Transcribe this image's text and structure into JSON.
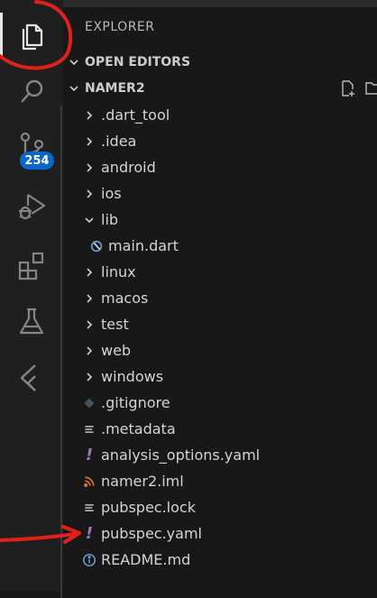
{
  "activity_bar": {
    "scm_badge": "254",
    "icons": [
      "files-icon",
      "search-icon",
      "source-control-icon",
      "run-debug-icon",
      "extensions-icon",
      "testing-icon",
      "flutter-icon"
    ]
  },
  "explorer": {
    "title": "EXPLORER",
    "open_editors_label": "OPEN EDITORS",
    "project_label": "NAMER2",
    "tree": [
      {
        "label": ".dart_tool",
        "kind": "folder"
      },
      {
        "label": ".idea",
        "kind": "folder"
      },
      {
        "label": "android",
        "kind": "folder"
      },
      {
        "label": "ios",
        "kind": "folder"
      },
      {
        "label": "lib",
        "kind": "folder-open"
      },
      {
        "label": "main.dart",
        "kind": "dart"
      },
      {
        "label": "linux",
        "kind": "folder"
      },
      {
        "label": "macos",
        "kind": "folder"
      },
      {
        "label": "test",
        "kind": "folder"
      },
      {
        "label": "web",
        "kind": "folder"
      },
      {
        "label": "windows",
        "kind": "folder"
      },
      {
        "label": ".gitignore",
        "kind": "git"
      },
      {
        "label": ".metadata",
        "kind": "lines"
      },
      {
        "label": "analysis_options.yaml",
        "kind": "yaml"
      },
      {
        "label": "namer2.iml",
        "kind": "rss"
      },
      {
        "label": "pubspec.lock",
        "kind": "lines"
      },
      {
        "label": "pubspec.yaml",
        "kind": "yaml"
      },
      {
        "label": "README.md",
        "kind": "info"
      }
    ]
  },
  "colors": {
    "badge": "#0a66c8",
    "yaml_icon": "#a074c4",
    "rss_icon": "#e37933",
    "dart_icon": "#5a9bd5",
    "annotation": "#e0201a"
  }
}
